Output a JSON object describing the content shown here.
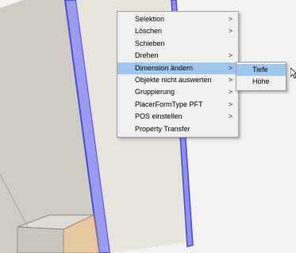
{
  "menu": {
    "items": [
      {
        "label": "Selektion",
        "arrow": ">"
      },
      {
        "label": "Löschen",
        "arrow": ">"
      },
      {
        "label": "Schieben",
        "arrow": ""
      },
      {
        "label": "Drehen",
        "arrow": ">"
      },
      {
        "label": "Dimension ändern",
        "arrow": ">"
      },
      {
        "label": "Objekte nicht auswerten",
        "arrow": ">"
      },
      {
        "label": "Gruppierung",
        "arrow": ">"
      },
      {
        "label": "PlacerFormType PFT",
        "arrow": ">"
      },
      {
        "label": "POS einstellen",
        "arrow": ">"
      },
      {
        "label": "Property Transfer",
        "arrow": ""
      }
    ]
  },
  "submenu": {
    "items": [
      {
        "label": "Tiefe"
      },
      {
        "label": "Höhe"
      }
    ]
  },
  "colors": {
    "highlight": "#9ec5ec",
    "selection_outline": "#6e6ef2",
    "cabinet_panel": "#d4d1cb",
    "wood_drawer": "#e9c7a0"
  }
}
